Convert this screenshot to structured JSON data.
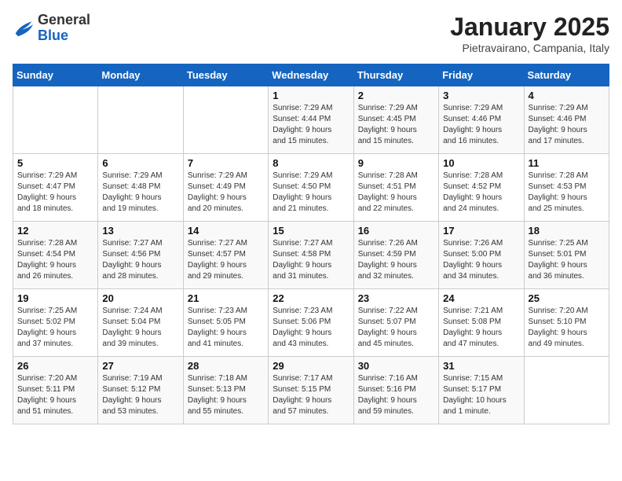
{
  "header": {
    "logo_general": "General",
    "logo_blue": "Blue",
    "title": "January 2025",
    "subtitle": "Pietravairano, Campania, Italy"
  },
  "weekdays": [
    "Sunday",
    "Monday",
    "Tuesday",
    "Wednesday",
    "Thursday",
    "Friday",
    "Saturday"
  ],
  "weeks": [
    [
      {
        "day": "",
        "info": ""
      },
      {
        "day": "",
        "info": ""
      },
      {
        "day": "",
        "info": ""
      },
      {
        "day": "1",
        "info": "Sunrise: 7:29 AM\nSunset: 4:44 PM\nDaylight: 9 hours\nand 15 minutes."
      },
      {
        "day": "2",
        "info": "Sunrise: 7:29 AM\nSunset: 4:45 PM\nDaylight: 9 hours\nand 15 minutes."
      },
      {
        "day": "3",
        "info": "Sunrise: 7:29 AM\nSunset: 4:46 PM\nDaylight: 9 hours\nand 16 minutes."
      },
      {
        "day": "4",
        "info": "Sunrise: 7:29 AM\nSunset: 4:46 PM\nDaylight: 9 hours\nand 17 minutes."
      }
    ],
    [
      {
        "day": "5",
        "info": "Sunrise: 7:29 AM\nSunset: 4:47 PM\nDaylight: 9 hours\nand 18 minutes."
      },
      {
        "day": "6",
        "info": "Sunrise: 7:29 AM\nSunset: 4:48 PM\nDaylight: 9 hours\nand 19 minutes."
      },
      {
        "day": "7",
        "info": "Sunrise: 7:29 AM\nSunset: 4:49 PM\nDaylight: 9 hours\nand 20 minutes."
      },
      {
        "day": "8",
        "info": "Sunrise: 7:29 AM\nSunset: 4:50 PM\nDaylight: 9 hours\nand 21 minutes."
      },
      {
        "day": "9",
        "info": "Sunrise: 7:28 AM\nSunset: 4:51 PM\nDaylight: 9 hours\nand 22 minutes."
      },
      {
        "day": "10",
        "info": "Sunrise: 7:28 AM\nSunset: 4:52 PM\nDaylight: 9 hours\nand 24 minutes."
      },
      {
        "day": "11",
        "info": "Sunrise: 7:28 AM\nSunset: 4:53 PM\nDaylight: 9 hours\nand 25 minutes."
      }
    ],
    [
      {
        "day": "12",
        "info": "Sunrise: 7:28 AM\nSunset: 4:54 PM\nDaylight: 9 hours\nand 26 minutes."
      },
      {
        "day": "13",
        "info": "Sunrise: 7:27 AM\nSunset: 4:56 PM\nDaylight: 9 hours\nand 28 minutes."
      },
      {
        "day": "14",
        "info": "Sunrise: 7:27 AM\nSunset: 4:57 PM\nDaylight: 9 hours\nand 29 minutes."
      },
      {
        "day": "15",
        "info": "Sunrise: 7:27 AM\nSunset: 4:58 PM\nDaylight: 9 hours\nand 31 minutes."
      },
      {
        "day": "16",
        "info": "Sunrise: 7:26 AM\nSunset: 4:59 PM\nDaylight: 9 hours\nand 32 minutes."
      },
      {
        "day": "17",
        "info": "Sunrise: 7:26 AM\nSunset: 5:00 PM\nDaylight: 9 hours\nand 34 minutes."
      },
      {
        "day": "18",
        "info": "Sunrise: 7:25 AM\nSunset: 5:01 PM\nDaylight: 9 hours\nand 36 minutes."
      }
    ],
    [
      {
        "day": "19",
        "info": "Sunrise: 7:25 AM\nSunset: 5:02 PM\nDaylight: 9 hours\nand 37 minutes."
      },
      {
        "day": "20",
        "info": "Sunrise: 7:24 AM\nSunset: 5:04 PM\nDaylight: 9 hours\nand 39 minutes."
      },
      {
        "day": "21",
        "info": "Sunrise: 7:23 AM\nSunset: 5:05 PM\nDaylight: 9 hours\nand 41 minutes."
      },
      {
        "day": "22",
        "info": "Sunrise: 7:23 AM\nSunset: 5:06 PM\nDaylight: 9 hours\nand 43 minutes."
      },
      {
        "day": "23",
        "info": "Sunrise: 7:22 AM\nSunset: 5:07 PM\nDaylight: 9 hours\nand 45 minutes."
      },
      {
        "day": "24",
        "info": "Sunrise: 7:21 AM\nSunset: 5:08 PM\nDaylight: 9 hours\nand 47 minutes."
      },
      {
        "day": "25",
        "info": "Sunrise: 7:20 AM\nSunset: 5:10 PM\nDaylight: 9 hours\nand 49 minutes."
      }
    ],
    [
      {
        "day": "26",
        "info": "Sunrise: 7:20 AM\nSunset: 5:11 PM\nDaylight: 9 hours\nand 51 minutes."
      },
      {
        "day": "27",
        "info": "Sunrise: 7:19 AM\nSunset: 5:12 PM\nDaylight: 9 hours\nand 53 minutes."
      },
      {
        "day": "28",
        "info": "Sunrise: 7:18 AM\nSunset: 5:13 PM\nDaylight: 9 hours\nand 55 minutes."
      },
      {
        "day": "29",
        "info": "Sunrise: 7:17 AM\nSunset: 5:15 PM\nDaylight: 9 hours\nand 57 minutes."
      },
      {
        "day": "30",
        "info": "Sunrise: 7:16 AM\nSunset: 5:16 PM\nDaylight: 9 hours\nand 59 minutes."
      },
      {
        "day": "31",
        "info": "Sunrise: 7:15 AM\nSunset: 5:17 PM\nDaylight: 10 hours\nand 1 minute."
      },
      {
        "day": "",
        "info": ""
      }
    ]
  ]
}
